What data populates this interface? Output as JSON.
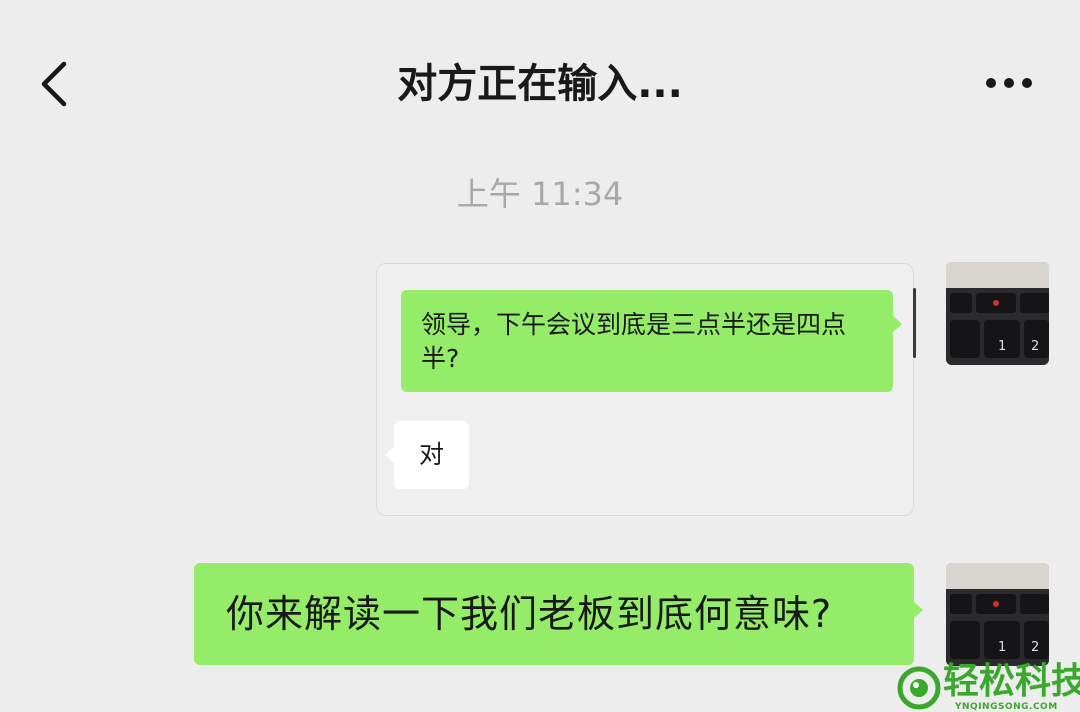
{
  "header": {
    "title": "对方正在输入...",
    "back_icon": "chevron-left-icon",
    "more_icon": "ellipsis-icon"
  },
  "chat": {
    "timestamp": "上午 11:34",
    "quoted_card": {
      "message_1": "领导，下午会议到底是三点半还是四点半?",
      "message_2": "对"
    },
    "message": "你来解读一下我们老板到底何意味?"
  },
  "watermark": {
    "title": "轻松科技",
    "subtitle": "YNQINGSONG.COM"
  },
  "colors": {
    "background": "#ededed",
    "bubble_green": "#95ec69",
    "bubble_white": "#ffffff",
    "watermark_green": "#3aa82c"
  }
}
